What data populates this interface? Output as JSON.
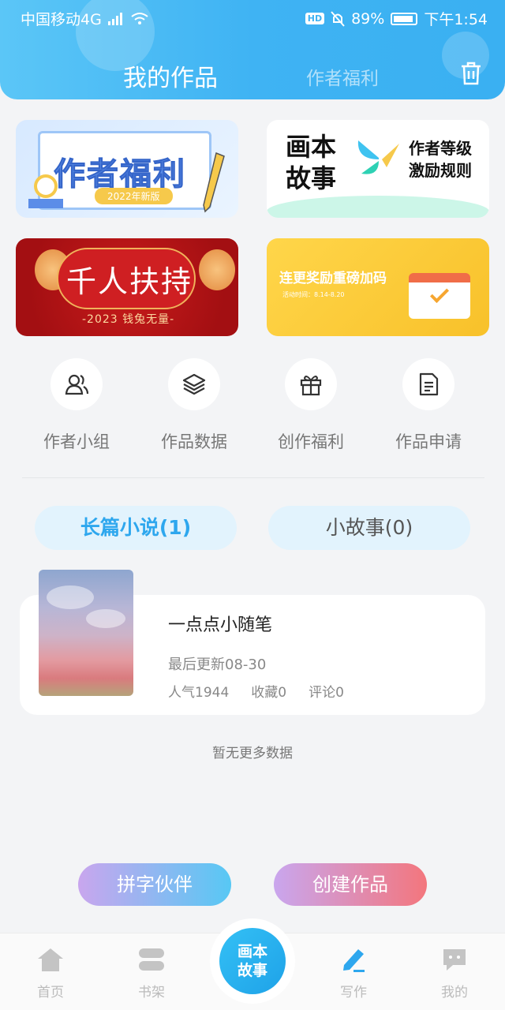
{
  "status_bar": {
    "carrier": "中国移动4G",
    "network_badge": "4G",
    "hd": "HD",
    "battery": "89%",
    "time": "下午1:54"
  },
  "header": {
    "tab_active": "我的作品",
    "tab_inactive": "作者福利",
    "trash_icon": "trash-icon",
    "gradient": [
      "#5bc6f7",
      "#3ab0f2"
    ]
  },
  "banners": {
    "welfare": {
      "title": "作者福利",
      "subtitle": "2022年新版"
    },
    "level": {
      "brand": "画本\n故事",
      "line1": "作者等级",
      "line2": "激励规则"
    },
    "support": {
      "title": "千人扶持",
      "subtitle": "-2023 钱兔无量-"
    },
    "update": {
      "title": "连更奖励重磅加码",
      "subtitle": "活动时间：8.14-8.20"
    }
  },
  "shortcuts": [
    {
      "label": "作者小组",
      "icon": "users-icon"
    },
    {
      "label": "作品数据",
      "icon": "layers-icon"
    },
    {
      "label": "创作福利",
      "icon": "gift-icon"
    },
    {
      "label": "作品申请",
      "icon": "document-icon"
    }
  ],
  "content_tabs": {
    "novels": "长篇小说(1)",
    "stories": "小故事(0)"
  },
  "works": [
    {
      "title": "一点点小随笔",
      "updated": "最后更新08-30",
      "popularity": "人气1944",
      "favorites": "收藏0",
      "comments": "评论0"
    }
  ],
  "no_more": "暂无更多数据",
  "actions": {
    "partner": "拼字伙伴",
    "create": "创建作品"
  },
  "bottom_nav": {
    "home": "首页",
    "shelf": "书架",
    "center_line1": "画本",
    "center_line2": "故事",
    "write": "写作",
    "mine": "我的"
  },
  "colors": {
    "accent": "#2ea7ee",
    "tab_bg": "#e2f3fd"
  }
}
